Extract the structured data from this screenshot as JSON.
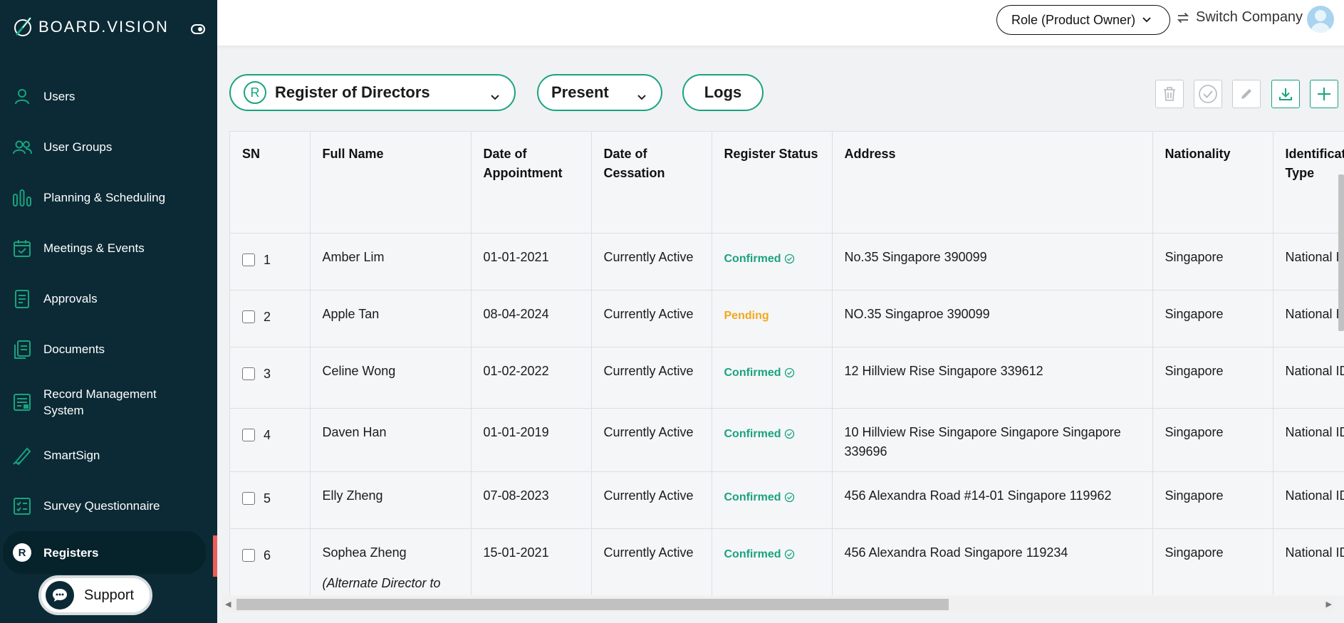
{
  "brand": {
    "name": "BOARD.VISION"
  },
  "sidebar": {
    "items": [
      {
        "label": "Users",
        "icon": "user-icon"
      },
      {
        "label": "User Groups",
        "icon": "user-group-icon"
      },
      {
        "label": "Planning & Scheduling",
        "icon": "bar-chart-icon"
      },
      {
        "label": "Meetings & Events",
        "icon": "calendar-check-icon"
      },
      {
        "label": "Approvals",
        "icon": "document-approve-icon"
      },
      {
        "label": "Documents",
        "icon": "documents-icon"
      },
      {
        "label": "Record Management System",
        "icon": "record-management-icon"
      },
      {
        "label": "SmartSign",
        "icon": "pen-icon"
      },
      {
        "label": "Survey Questionnaire",
        "icon": "checklist-icon"
      },
      {
        "label": "Registers",
        "icon": "registers-icon",
        "badge": "R",
        "active": true
      }
    ],
    "support_label": "Support"
  },
  "topbar": {
    "role_label": "Role (Product Owner)",
    "switch_company_label": "Switch Company"
  },
  "toolbar": {
    "register_badge": "R",
    "register_select": "Register of Directors",
    "period_select": "Present",
    "logs_label": "Logs"
  },
  "table": {
    "columns": [
      "SN",
      "Full Name",
      "Date of Appointment",
      "Date of Cessation",
      "Register Status",
      "Address",
      "Nationality",
      "Identification Type"
    ],
    "rows": [
      {
        "sn": "1",
        "name": "Amber Lim",
        "appointment": "01-01-2021",
        "cessation": "Currently Active",
        "status": "Confirmed",
        "address": "No.35 Singapore 390099",
        "nationality": "Singapore",
        "id_type": "National ID"
      },
      {
        "sn": "2",
        "name": "Apple Tan",
        "appointment": "08-04-2024",
        "cessation": "Currently Active",
        "status": "Pending",
        "address": "NO.35 Singaproe 390099",
        "nationality": "Singapore",
        "id_type": "National ID"
      },
      {
        "sn": "3",
        "name": "Celine Wong",
        "appointment": "01-02-2022",
        "cessation": "Currently Active",
        "status": "Confirmed",
        "address": "12 Hillview Rise Singapore 339612",
        "nationality": "Singapore",
        "id_type": "National ID"
      },
      {
        "sn": "4",
        "name": "Daven Han",
        "appointment": "01-01-2019",
        "cessation": "Currently Active",
        "status": "Confirmed",
        "address": "10 Hillview Rise Singapore Singapore Singapore 339696",
        "nationality": "Singapore",
        "id_type": "National ID"
      },
      {
        "sn": "5",
        "name": "Elly Zheng",
        "appointment": "07-08-2023",
        "cessation": "Currently Active",
        "status": "Confirmed",
        "address": "456 Alexandra Road #14-01 Singapore 119962",
        "nationality": "Singapore",
        "id_type": "National ID"
      },
      {
        "sn": "6",
        "name": "Sophea Zheng",
        "note": "(Alternate Director to",
        "appointment": "15-01-2021",
        "cessation": "Currently Active",
        "status": "Confirmed",
        "address": "456 Alexandra Road Singapore 119234",
        "nationality": "Singapore",
        "id_type": "National ID"
      }
    ]
  },
  "colors": {
    "sidebar_bg": "#0b2a35",
    "accent": "#19a37e",
    "pending": "#f2a81d",
    "active_marker": "#ef5a5a"
  }
}
